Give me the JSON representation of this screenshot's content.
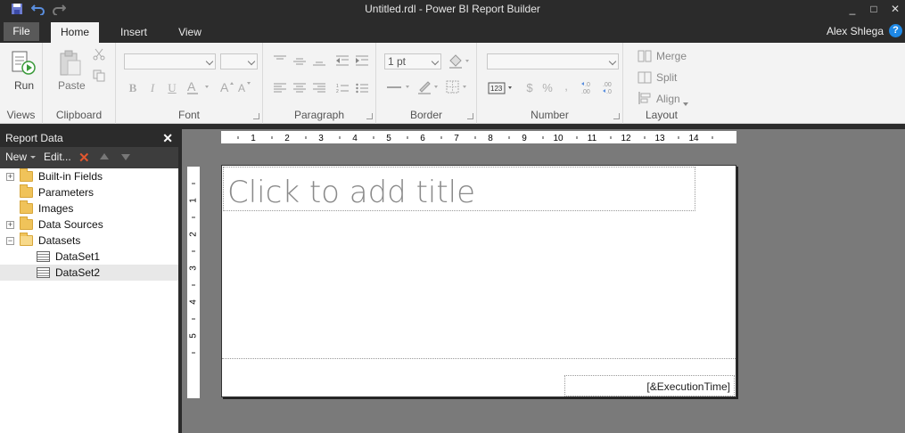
{
  "window": {
    "title": "Untitled.rdl - Power BI Report Builder",
    "minimize": "_",
    "maximize": "□",
    "close": "✕"
  },
  "tabs": {
    "file": "File",
    "items": [
      "Home",
      "Insert",
      "View"
    ],
    "active": "Home"
  },
  "user": {
    "name": "Alex Shlega",
    "help": "?"
  },
  "ribbon": {
    "views": {
      "label": "Views",
      "run": "Run"
    },
    "clipboard": {
      "label": "Clipboard",
      "paste": "Paste"
    },
    "font": {
      "label": "Font",
      "bold": "B",
      "italic": "I",
      "underline": "U"
    },
    "paragraph": {
      "label": "Paragraph"
    },
    "border": {
      "label": "Border",
      "width": "1 pt"
    },
    "number": {
      "label": "Number",
      "placeholder": "[123]",
      "currency": "$",
      "percent": "%",
      "comma": ",",
      "inc_decimal": "←.0\n.00",
      "dec_decimal": ".00\n→.0"
    },
    "layout": {
      "label": "Layout",
      "merge": "Merge",
      "split": "Split",
      "align": "Align"
    }
  },
  "report_data": {
    "title": "Report Data",
    "new": "New",
    "edit": "Edit...",
    "tree": [
      {
        "label": "Built-in Fields",
        "type": "folder",
        "expander": "+"
      },
      {
        "label": "Parameters",
        "type": "folder",
        "expander": ""
      },
      {
        "label": "Images",
        "type": "folder",
        "expander": ""
      },
      {
        "label": "Data Sources",
        "type": "folder",
        "expander": "+"
      },
      {
        "label": "Datasets",
        "type": "folder",
        "expander": "−"
      },
      {
        "label": "DataSet1",
        "type": "dataset",
        "expander": ""
      },
      {
        "label": "DataSet2",
        "type": "dataset",
        "expander": "",
        "selected": true
      }
    ]
  },
  "rulers": {
    "horizontal": [
      "1",
      "2",
      "3",
      "4",
      "5",
      "6",
      "7",
      "8",
      "9",
      "10",
      "11",
      "12",
      "13",
      "14"
    ],
    "vertical": [
      "1",
      "2",
      "3",
      "4",
      "5"
    ]
  },
  "report": {
    "title_placeholder": "Click to add title",
    "execution_time": "[&ExecutionTime]"
  }
}
